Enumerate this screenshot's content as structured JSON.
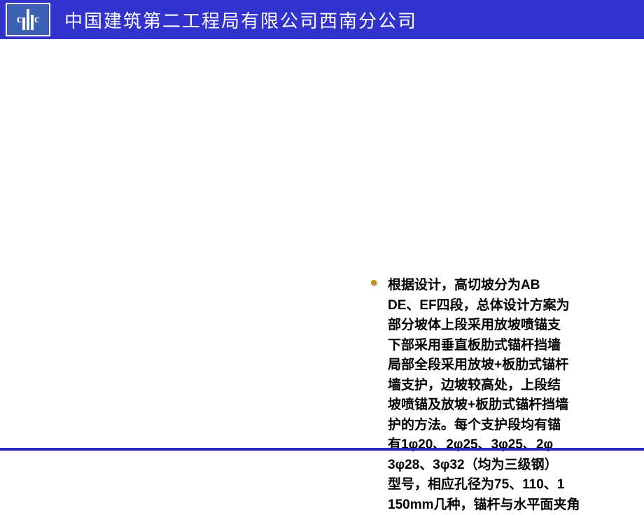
{
  "header": {
    "logo_alt": "cSCEc",
    "title": "中国建筑第二工程局有限公司西南分公司"
  },
  "content": {
    "bullet_line1": "根据设计，高切坡分为AB",
    "bullet_rest": "DE、EF四段，总体设计方案为\n部分坡体上段采用放坡喷锚支\n下部采用垂直板肋式锚杆挡墙\n局部全段采用放坡+板肋式锚杆\n墙支护，边坡较高处，上段结\n坡喷锚及放坡+板肋式锚杆挡墙\n护的方法。每个支护段均有锚\n有1φ20、2φ25、3φ25、2φ\n3φ28、3φ32（均为三级钢）",
    "bullet_below": "型号，相应孔径为75、110、1\n150mm几种，锚杆与水平面夹角"
  }
}
